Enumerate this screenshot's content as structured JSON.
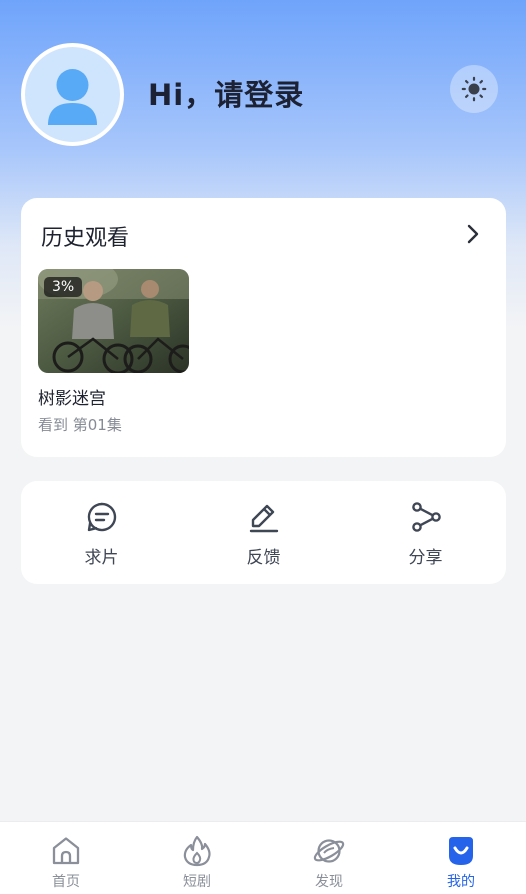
{
  "header": {
    "greeting": "Hi，请登录",
    "avatar_icon": "user-icon",
    "theme_icon": "sun-icon"
  },
  "history": {
    "title": "历史观看",
    "more_icon": "chevron-right-icon",
    "items": [
      {
        "progress": "3%",
        "title": "树影迷宫",
        "subtitle": "看到 第01集"
      }
    ]
  },
  "actions": [
    {
      "label": "求片",
      "icon": "message-icon"
    },
    {
      "label": "反馈",
      "icon": "edit-icon"
    },
    {
      "label": "分享",
      "icon": "share-icon"
    }
  ],
  "tabbar": {
    "tabs": [
      {
        "label": "首页",
        "icon": "home-icon",
        "active": false
      },
      {
        "label": "短剧",
        "icon": "flame-icon",
        "active": false
      },
      {
        "label": "发现",
        "icon": "planet-icon",
        "active": false
      },
      {
        "label": "我的",
        "icon": "smile-icon",
        "active": true
      }
    ]
  },
  "colors": {
    "accent": "#2563eb",
    "header_gradient_top": "#6fa4fb",
    "background": "#f3f4f6"
  }
}
